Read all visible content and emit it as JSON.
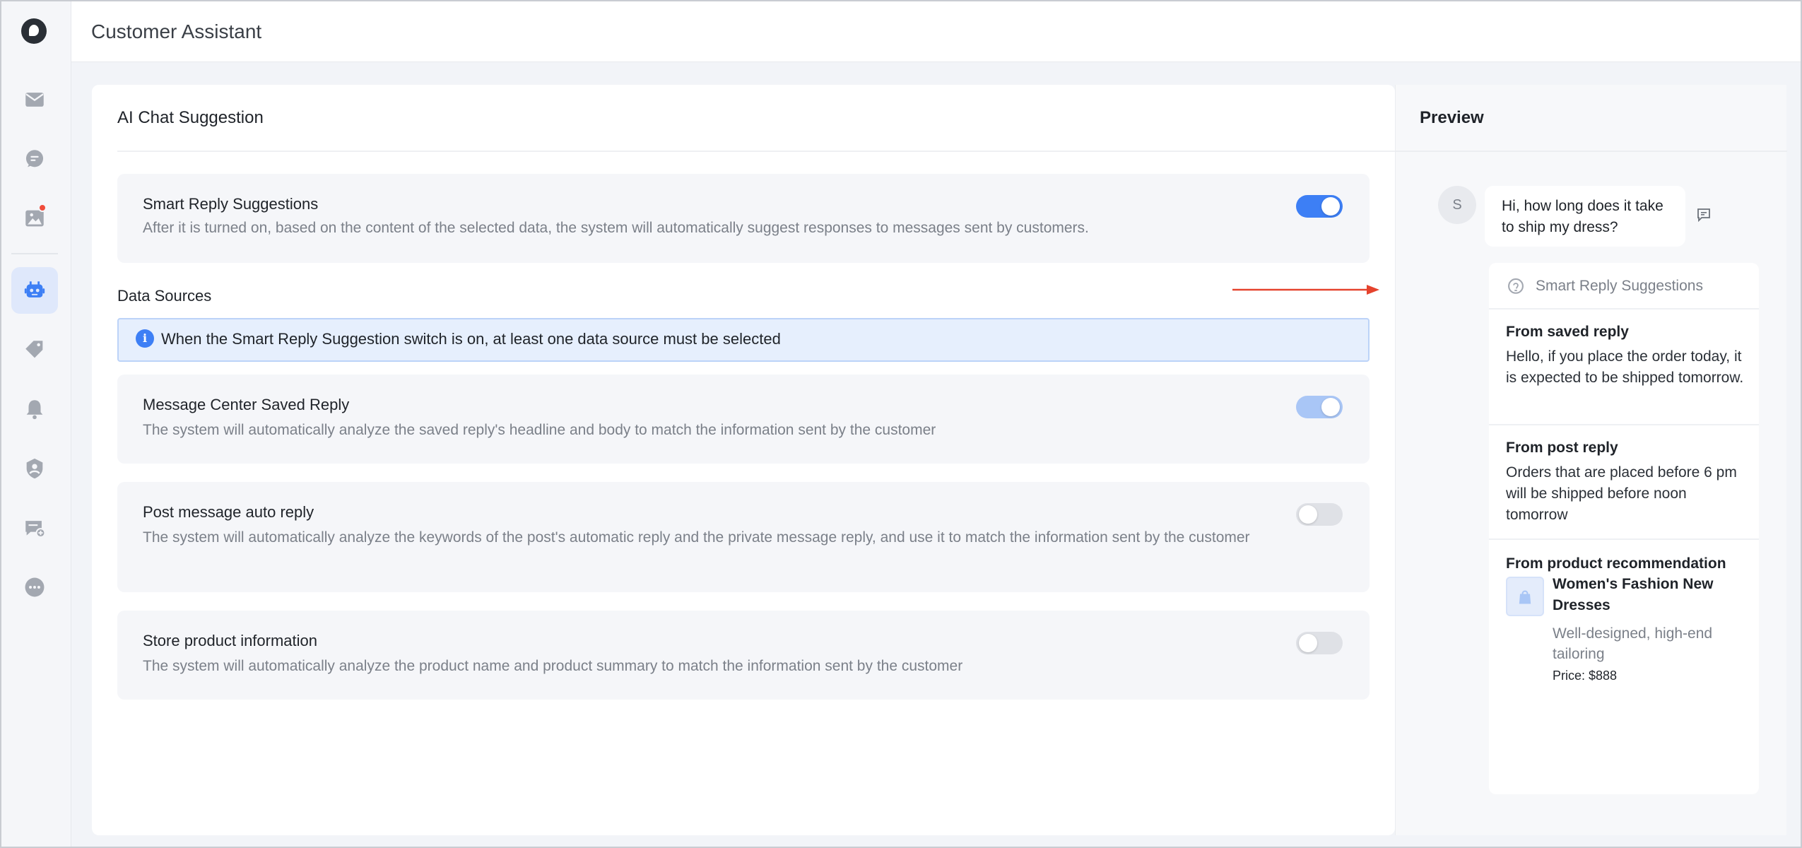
{
  "app": {
    "title": "Customer Assistant"
  },
  "sidebar": {
    "items": [
      {
        "icon": "mail-icon"
      },
      {
        "icon": "chat-icon"
      },
      {
        "icon": "image-icon",
        "badge": true
      },
      {
        "icon": "robot-icon",
        "active": true
      },
      {
        "icon": "tag-icon"
      },
      {
        "icon": "bell-icon"
      },
      {
        "icon": "user-shield-icon"
      },
      {
        "icon": "message-add-icon"
      },
      {
        "icon": "more-icon"
      }
    ]
  },
  "main": {
    "title": "AI Chat Suggestion",
    "smart_reply": {
      "name": "Smart Reply Suggestions",
      "description": "After it is turned on, based on the content of the selected data, the system will automatically suggest responses to messages sent by customers.",
      "enabled": true
    },
    "data_sources_label": "Data Sources",
    "info": "When the Smart Reply Suggestion switch is on, at least one data source must be selected",
    "sources": [
      {
        "name": "Message Center Saved Reply",
        "description": "The system will automatically analyze the saved reply's headline and body to match the information sent by the customer",
        "state": "on-disabled"
      },
      {
        "name": "Post message auto reply",
        "description": "The system will automatically analyze the keywords of the post's automatic reply and the private message reply, and use it to match the information sent by the customer",
        "state": "off"
      },
      {
        "name": "Store product information",
        "description": "The system will automatically analyze the product name and product summary to match the information sent by the customer",
        "state": "off"
      }
    ]
  },
  "preview": {
    "title": "Preview",
    "avatar_initial": "S",
    "customer_message": "Hi, how long does it take to ship my dress?",
    "suggestions_header": "Smart Reply Suggestions",
    "saved_reply": {
      "label": "From saved reply",
      "text": "Hello, if you place the order today, it is expected to be shipped tomorrow."
    },
    "post_reply": {
      "label": "From post reply",
      "text": "Orders that are placed before 6 pm will be shipped before noon tomorrow"
    },
    "product": {
      "label": "From product recommendation",
      "name": "Women's Fashion New Dresses",
      "description": "Well-designed, high-end tailoring",
      "price": "Price: $888"
    }
  },
  "colors": {
    "accent": "#3d7ff5",
    "arrow": "#e5432d",
    "badge": "#f04c3b"
  }
}
